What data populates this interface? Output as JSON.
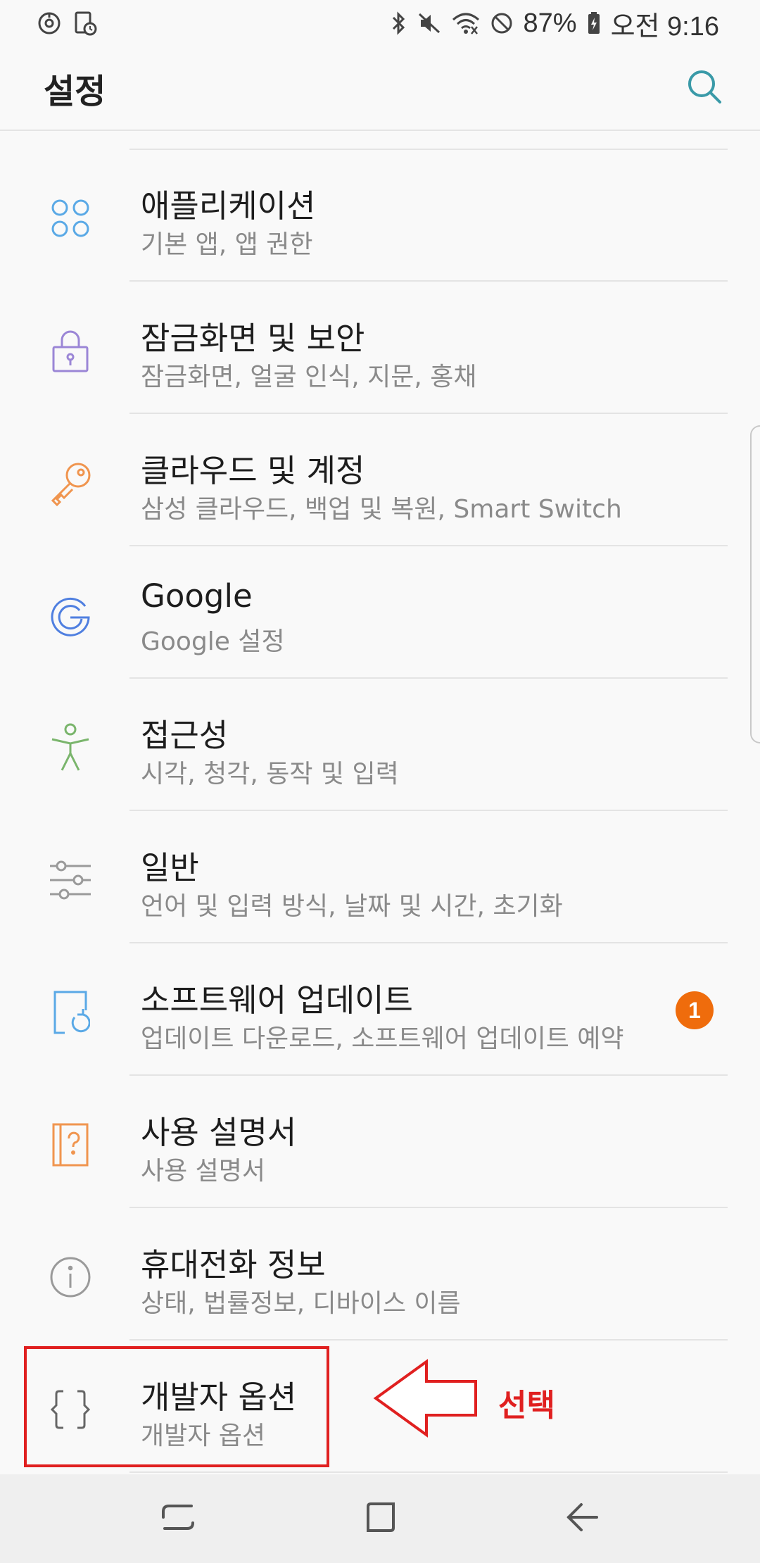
{
  "status_bar": {
    "battery": "87%",
    "time": "오전 9:16",
    "icons": [
      "sync-icon",
      "screen-record-icon",
      "bluetooth-icon",
      "mute-icon",
      "wifi-icon",
      "dnd-icon",
      "battery-icon"
    ]
  },
  "header": {
    "title": "설정",
    "search_icon": "search-icon"
  },
  "settings_items": [
    {
      "title": "애플리케이션",
      "subtitle": "기본 앱, 앱 권한",
      "icon": "apps-icon",
      "color": "#5aa9e6"
    },
    {
      "title": "잠금화면 및 보안",
      "subtitle": "잠금화면, 얼굴 인식, 지문, 홍채",
      "icon": "lock-icon",
      "color": "#9b86d6"
    },
    {
      "title": "클라우드 및 계정",
      "subtitle": "삼성 클라우드, 백업 및 복원, Smart Switch",
      "icon": "key-icon",
      "color": "#f0954f"
    },
    {
      "title": "Google",
      "subtitle": "Google 설정",
      "icon": "google-icon",
      "color": "#4f7fe0"
    },
    {
      "title": "접근성",
      "subtitle": "시각, 청각, 동작 및 입력",
      "icon": "accessibility-icon",
      "color": "#7ab56c"
    },
    {
      "title": "일반",
      "subtitle": "언어 및 입력 방식, 날짜 및 시간, 초기화",
      "icon": "sliders-icon",
      "color": "#9a9a9a"
    },
    {
      "title": "소프트웨어 업데이트",
      "subtitle": "업데이트 다운로드, 소프트웨어 업데이트 예약",
      "icon": "software-update-icon",
      "color": "#5aa9e6",
      "badge": "1"
    },
    {
      "title": "사용 설명서",
      "subtitle": "사용 설명서",
      "icon": "user-manual-icon",
      "color": "#f0954f"
    },
    {
      "title": "휴대전화 정보",
      "subtitle": "상태, 법률정보, 디바이스 이름",
      "icon": "info-icon",
      "color": "#9a9a9a"
    },
    {
      "title": "개발자 옵션",
      "subtitle": "개발자 옵션",
      "icon": "developer-braces-icon",
      "color": "#666666"
    }
  ],
  "annotation": {
    "label": "선택",
    "color": "#e02020"
  },
  "nav_bar": {
    "icons": [
      "recents-icon",
      "home-icon",
      "back-icon"
    ]
  }
}
